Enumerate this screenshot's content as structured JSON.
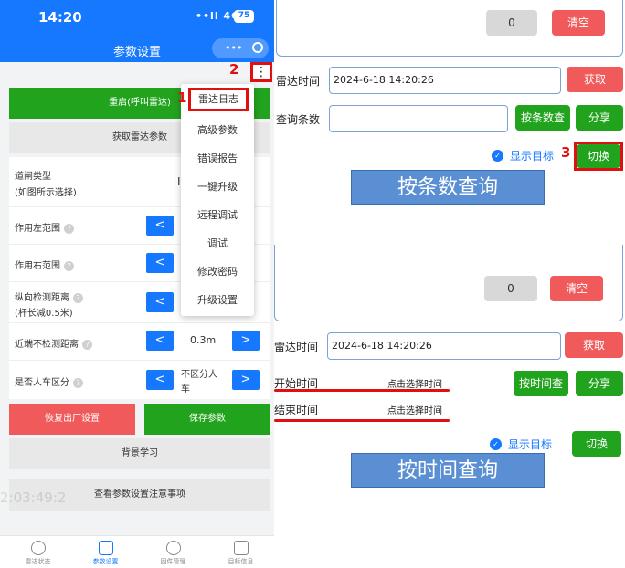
{
  "status_bar": {
    "time": "14:20",
    "signal": "••ll 4G",
    "battery": "75"
  },
  "header": {
    "title": "参数设置",
    "dots": "•••"
  },
  "annotations": {
    "n1": "1",
    "n2": "2",
    "n3": "3"
  },
  "more_button": "⋮",
  "left": {
    "restart_btn": "重启(呼叫雷达)",
    "get_params_btn": "获取雷达参数",
    "gate_type": {
      "label_line1": "道闸类型",
      "label_line2": "(如图所示选择)",
      "value": "I"
    },
    "left_range": {
      "label": "作用左范围",
      "dec": "<"
    },
    "right_range": {
      "label": "作用右范围",
      "dec": "<"
    },
    "vertical": {
      "label_line1": "纵向检测距离",
      "label_line2": "(杆长减0.5米)",
      "dec": "<"
    },
    "near": {
      "label": "近端不检测距离",
      "dec": "<",
      "value": "0.3m",
      "inc": ">"
    },
    "person_car": {
      "label": "是否人车区分",
      "dec": "<",
      "value_line1": "不区分人",
      "value_line2": "车",
      "inc": ">"
    },
    "reset_btn": "恢复出厂设置",
    "save_btn": "保存参数",
    "bg_btn": "背景学习",
    "notes_btn": "查看参数设置注意事项",
    "watermark_time": "2:03:49:2"
  },
  "menu_items": [
    "雷达日志",
    "高级参数",
    "错误报告",
    "一键升级",
    "远程调试",
    "调试",
    "修改密码",
    "升级设置"
  ],
  "tabs": [
    "雷达状态",
    "参数设置",
    "固件管理",
    "目标信息"
  ],
  "top_panel": {
    "count": "0",
    "clear": "清空",
    "radar_time_label": "雷达时间",
    "radar_time": "2024-6-18 14:20:26",
    "get": "获取",
    "count_label": "查询条数",
    "count_query": "按条数查",
    "share": "分享",
    "show_target": "显示目标",
    "switch": "切换",
    "banner": "按条数查询"
  },
  "bottom_panel": {
    "count": "0",
    "clear": "清空",
    "radar_time_label": "雷达时间",
    "radar_time": "2024-6-18 14:20:26",
    "get": "获取",
    "start_label": "开始时间",
    "start_value": "点击选择时间",
    "end_label": "结束时间",
    "end_value": "点击选择时间",
    "time_query": "按时间查",
    "share": "分享",
    "show_target": "显示目标",
    "switch": "切换",
    "banner": "按时间查询"
  },
  "colors": {
    "primary": "#1677ff",
    "green": "#22a31e",
    "red": "#f05a5a",
    "annotation": "#e01010",
    "banner": "#5b8fd4"
  }
}
